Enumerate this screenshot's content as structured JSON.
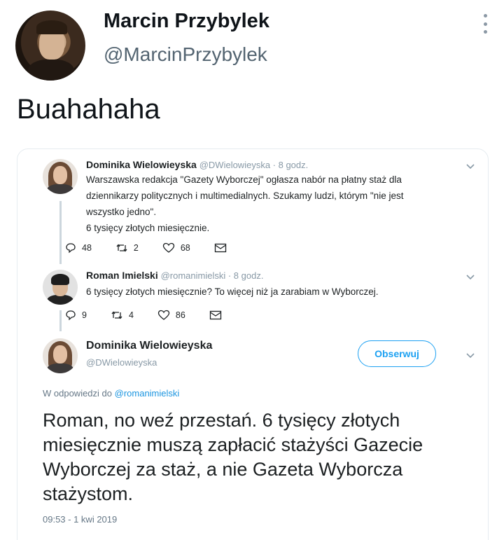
{
  "outer_tweet": {
    "name": "Marcin Przybylek",
    "handle": "@MarcinPrzybylek",
    "text": "Buahahaha",
    "more_icon": "three-dots-vertical"
  },
  "embed": {
    "tweet1": {
      "name": "Dominika Wielowieyska",
      "meta": "@DWielowieyska · 8 godz.",
      "lines": [
        "Warszawska redakcja \"Gazety Wyborczej\" ogłasza nabór na płatny staż dla",
        "dziennikarzy politycznych i multimedialnych. Szukamy ludzi, którym \"nie jest",
        "wszystko jedno\".",
        "6 tysięcy złotych miesięcznie."
      ],
      "replies": "48",
      "retweets": "2",
      "likes": "68"
    },
    "tweet2": {
      "name": "Roman Imielski",
      "meta": "@romanimielski · 8 godz.",
      "text": "6 tysięcy złotych miesięcznie? To więcej niż ja zarabiam w Wyborczej.",
      "replies": "9",
      "retweets": "4",
      "likes": "86"
    },
    "tweet3": {
      "name": "Dominika Wielowieyska",
      "handle": "@DWielowieyska",
      "follow_label": "Obserwuj",
      "reply_prefix": "W odpowiedzi do",
      "reply_handle": "@romanimielski",
      "lines": [
        "Roman, no weź przestań. 6 tysięcy złotych",
        "miesięcznie muszą zapłacić stażyści Gazecie",
        "Wyborczej za staż, a nie Gazeta Wyborcza",
        "stażystom."
      ],
      "timestamp": "09:53 - 1 kwi 2019"
    },
    "accent_color": "#1da1f2"
  }
}
